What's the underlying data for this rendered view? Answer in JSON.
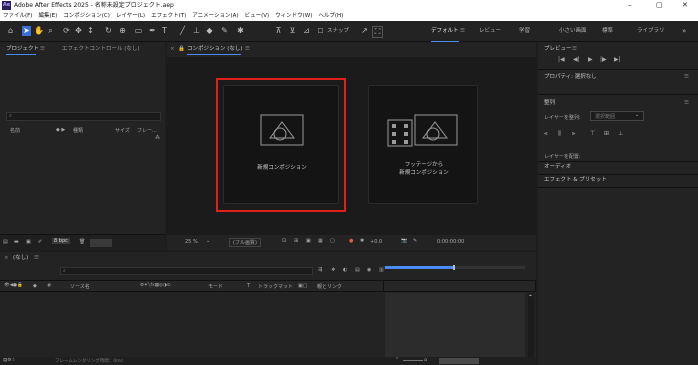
{
  "titlebar": {
    "app_icon": "Ae",
    "title": "Adobe After Effects 2025 - 名称未設定プロジェクト.aep",
    "min": "–",
    "max": "▢",
    "close": "✕"
  },
  "menu": [
    "ファイル(F)",
    "編集(E)",
    "コンポジション(C)",
    "レイヤー(L)",
    "エフェクト(T)",
    "アニメーション(A)",
    "ビュー(V)",
    "ウィンドウ(W)",
    "ヘルプ(H)"
  ],
  "toolbar": {
    "snap_label": "スナップ"
  },
  "workspaces": [
    "デフォルト",
    "レビュー",
    "学習",
    "小さい画面",
    "標準",
    "ライブラリ"
  ],
  "project": {
    "tab_project": "プロジェクト",
    "tab_effect": "エフェクトコントロール (なし)",
    "search_placeholder": "",
    "cols": [
      "名前",
      "種類",
      "サイズ",
      "フレー..."
    ],
    "bpc": "8 bpc"
  },
  "comp": {
    "tab": "コンポジション (なし)",
    "card1": "新規コンポジション",
    "card2_line1": "フッテージから",
    "card2_line2": "新規コンポジション",
    "zoom": "25 %",
    "resolution": "(フル画質)",
    "exposure": "+0.0",
    "time": "0:00:00:00"
  },
  "right": {
    "preview": "プレビュー",
    "properties": "プロパティ: 選択なし",
    "align": "整列",
    "align_to_label": "レイヤーを整列:",
    "align_to_value": "選択範囲",
    "distribute_label": "レイヤーを配置:",
    "audio": "オーディオ",
    "effects_presets": "エフェクト & プリセット"
  },
  "timeline": {
    "tab": "(なし)",
    "cols": [
      "ソース名",
      "モード",
      "T",
      "トラックマット",
      "親とリンク"
    ],
    "status": "フレームレンダリング時間：0ms"
  }
}
